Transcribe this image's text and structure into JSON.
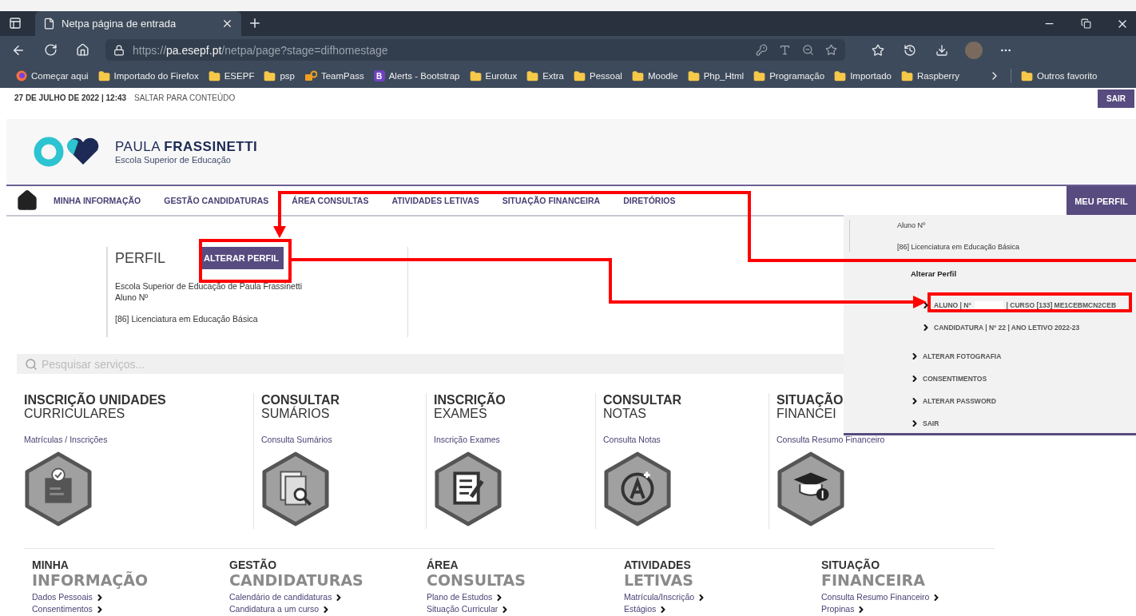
{
  "browser": {
    "tab_title": "Netpa página de entrada",
    "url": {
      "scheme": "https://",
      "host": "pa.esepf.pt",
      "path": "/netpa/page?stage=difhomestage"
    },
    "bookmarks": [
      {
        "label": "Começar aqui",
        "kind": "firefox"
      },
      {
        "label": "Importado do Firefox",
        "kind": "folder"
      },
      {
        "label": "ESEPF",
        "kind": "folder"
      },
      {
        "label": "psp",
        "kind": "folder"
      },
      {
        "label": "TeamPass",
        "kind": "teampass"
      },
      {
        "label": "Alerts - Bootstrap",
        "kind": "bootstrap",
        "glyph": "B"
      },
      {
        "label": "Eurotux",
        "kind": "folder"
      },
      {
        "label": "Extra",
        "kind": "folder"
      },
      {
        "label": "Pessoal",
        "kind": "folder"
      },
      {
        "label": "Moodle",
        "kind": "folder"
      },
      {
        "label": "Php_Html",
        "kind": "folder"
      },
      {
        "label": "Programação",
        "kind": "folder"
      },
      {
        "label": "Importado",
        "kind": "folder"
      },
      {
        "label": "Raspberry",
        "kind": "folder"
      }
    ],
    "other_bookmarks": "Outros favorito"
  },
  "topbar": {
    "date": "27 DE JULHO DE 2022 | 12:43",
    "skip_link": "SALTAR PARA CONTEÚDO",
    "logout": "SAIR"
  },
  "logo": {
    "name_light": "PAULA",
    "name_bold": "FRASSINETTI",
    "subtitle": "Escola Superior de Educação"
  },
  "nav": {
    "items": [
      "MINHA INFORMAÇÃO",
      "GESTÃO CANDIDATURAS",
      "ÁREA CONSULTAS",
      "ATIVIDADES LETIVAS",
      "SITUAÇÃO FINANCEIRA",
      "DIRETÓRIOS"
    ],
    "profile_button": "MEU PERFIL"
  },
  "profile": {
    "title": "PERFIL",
    "button": "ALTERAR PERFIL",
    "groups": [
      [
        "Escola Superior de Educação de Paula Frassinetti",
        "Aluno Nº"
      ],
      [
        "[86] Licenciatura em Educação Básica"
      ]
    ]
  },
  "search": {
    "placeholder": "Pesquisar serviços..."
  },
  "services": [
    {
      "title_bold": "INSCRIÇÃO UNIDADES",
      "title_light": "CURRICULARES",
      "link": "Matrículas / Inscrições",
      "kind": "clipboard"
    },
    {
      "title_bold": "CONSULTAR",
      "title_light": "SUMÁRIOS",
      "link": "Consulta Sumários",
      "kind": "document-search"
    },
    {
      "title_bold": "INSCRIÇÃO",
      "title_light": "EXAMES",
      "link": "Inscrição Exames",
      "kind": "form"
    },
    {
      "title_bold": "CONSULTAR",
      "title_light": "NOTAS",
      "link": "Consulta Notas",
      "kind": "grade"
    },
    {
      "title_bold": "SITUAÇÃO",
      "title_light": "FINANCEI",
      "link": "Consulta Resumo Financeiro",
      "kind": "graduate"
    }
  ],
  "sections": [
    {
      "title_small": "MINHA",
      "title_big": "INFORMAÇÃO",
      "links": [
        "Dados Pessoais",
        "Consentimentos"
      ]
    },
    {
      "title_small": "GESTÃO",
      "title_big": "CANDIDATURAS",
      "links": [
        "Calendário de candidaturas",
        "Candidatura a um curso"
      ]
    },
    {
      "title_small": "ÁREA",
      "title_big": "CONSULTAS",
      "links": [
        "Plano de Estudos",
        "Situação Curricular"
      ]
    },
    {
      "title_small": "ATIVIDADES",
      "title_big": "LETIVAS",
      "links": [
        "Matrícula/Inscrição",
        "Estágios"
      ]
    },
    {
      "title_small": "SITUAÇÃO",
      "title_big": "FINANCEIRA",
      "links": [
        "Consulta Resumo Financeiro",
        "Propinas"
      ]
    }
  ],
  "profile_menu": {
    "lines": [
      "Aluno Nº",
      "[86] Licenciatura em Educação Básica"
    ],
    "heading": "Alterar Perfil",
    "profiles": [
      {
        "label": "ALUNO | Nº",
        "suffix": "| CURSO [133] ME1CEBMCN2CEB",
        "redacted": true,
        "highlighted": true
      },
      {
        "label": "CANDIDATURA | Nº 22 | ANO LETIVO 2022-23",
        "redacted": false,
        "highlighted": false
      }
    ],
    "actions": [
      "ALTERAR FOTOGRAFIA",
      "CONSENTIMENTOS",
      "ALTERAR PASSWORD",
      "SAIR"
    ]
  }
}
